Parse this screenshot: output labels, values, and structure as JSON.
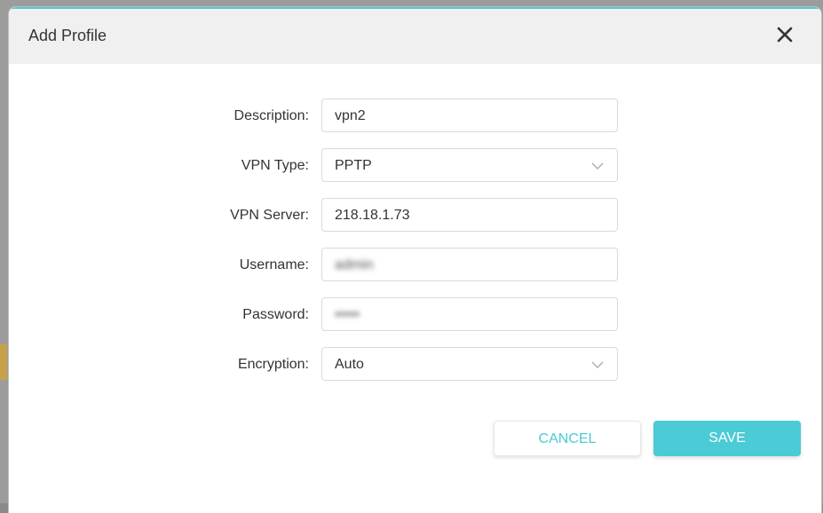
{
  "dialog": {
    "title": "Add Profile",
    "close_icon": "close-icon"
  },
  "form": {
    "description": {
      "label": "Description:",
      "value": "vpn2"
    },
    "vpn_type": {
      "label": "VPN Type:",
      "value": "PPTP",
      "icon": "chevron-down-icon"
    },
    "vpn_server": {
      "label": "VPN Server:",
      "value": "218.18.1.73"
    },
    "username": {
      "label": "Username:",
      "value": "admin"
    },
    "password": {
      "label": "Password:",
      "value": "•••••"
    },
    "encryption": {
      "label": "Encryption:",
      "value": "Auto",
      "icon": "chevron-down-icon"
    }
  },
  "buttons": {
    "cancel": "CANCEL",
    "save": "SAVE"
  },
  "colors": {
    "accent": "#4acbd6",
    "header_bg": "#f0f0f0",
    "text": "#333333"
  }
}
